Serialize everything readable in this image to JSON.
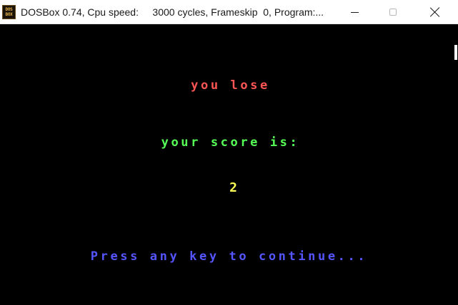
{
  "window": {
    "icon_text_top": "DOS",
    "icon_text_bottom": "BOX",
    "title": "DOSBox 0.74, Cpu speed:     3000 cycles, Frameskip  0, Program:..."
  },
  "screen": {
    "lose_text": "you lose",
    "score_label": "your score is:",
    "score_value": "2",
    "continue_prompt": "Press any key to continue..."
  },
  "colors": {
    "lose": "#ff5555",
    "score_label": "#55ff55",
    "score_value": "#ffff55",
    "continue_prompt": "#5555ff",
    "background": "#000000"
  },
  "icons": {
    "minimize": "minimize-icon",
    "maximize": "maximize-icon",
    "close": "close-icon"
  }
}
